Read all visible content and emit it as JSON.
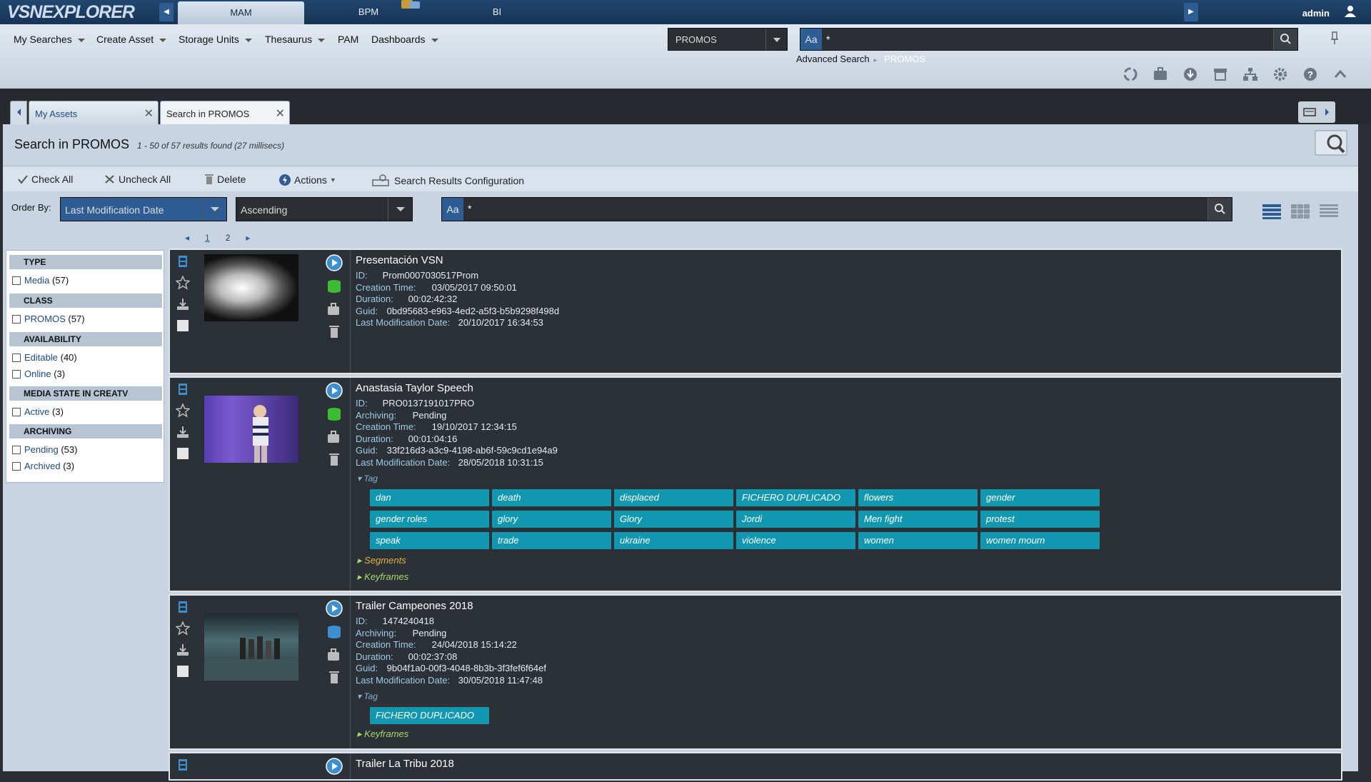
{
  "app": {
    "logo": "VSNEXPLORER",
    "user": "admin"
  },
  "top_tabs": [
    {
      "label": "MAM"
    },
    {
      "label": "BPM"
    },
    {
      "label": "BI"
    }
  ],
  "menu": {
    "items": [
      {
        "label": "My Searches"
      },
      {
        "label": "Create Asset"
      },
      {
        "label": "Storage Units"
      },
      {
        "label": "Thesaurus"
      },
      {
        "label": "PAM"
      },
      {
        "label": "Dashboards"
      }
    ],
    "scope_select": "PROMOS",
    "search": {
      "case_label": "Aa",
      "value": "*"
    },
    "breadcrumb": {
      "link": "Advanced Search",
      "current": "PROMOS"
    }
  },
  "work_tabs": [
    {
      "label": "My Assets"
    },
    {
      "label": "Search in PROMOS"
    }
  ],
  "panel": {
    "title": "Search in PROMOS",
    "count": "1 - 50 of 57 results found (27 millisecs)",
    "actions": {
      "check_all": "Check All",
      "uncheck_all": "Uncheck All",
      "delete": "Delete",
      "actions": "Actions",
      "config": "Search Results Configuration"
    },
    "order_by_label": "Order By:",
    "order_field": "Last Modification Date",
    "order_direction": "Ascending",
    "search": {
      "case_label": "Aa",
      "value": "*"
    },
    "pages": [
      "1",
      "2"
    ]
  },
  "facets": [
    {
      "title": "TYPE",
      "items": [
        {
          "label": "Media",
          "count": "(57)"
        }
      ]
    },
    {
      "title": "CLASS",
      "items": [
        {
          "label": "PROMOS",
          "count": "(57)"
        }
      ]
    },
    {
      "title": "AVAILABILITY",
      "items": [
        {
          "label": "Editable",
          "count": "(40)"
        },
        {
          "label": "Online",
          "count": "(3)"
        }
      ]
    },
    {
      "title": "MEDIA STATE IN CREATV",
      "items": [
        {
          "label": "Active",
          "count": "(3)"
        }
      ]
    },
    {
      "title": "ARCHIVING",
      "items": [
        {
          "label": "Pending",
          "count": "(53)"
        },
        {
          "label": "Archived",
          "count": "(3)"
        }
      ]
    }
  ],
  "results": [
    {
      "title": "Presentación VSN",
      "fields": [
        {
          "k": "ID:",
          "v": "Prom0007030517Prom"
        },
        {
          "k": "Creation Time:",
          "v": "03/05/2017 09:50:01"
        },
        {
          "k": "Duration:",
          "v": "00:02:42:32"
        },
        {
          "k": "Guid:",
          "v": "0bd95683-e963-4ed2-a5f3-b5b9298f498d"
        },
        {
          "k": "Last Modification Date:",
          "v": "20/10/2017 16:34:53"
        }
      ]
    },
    {
      "title": "Anastasia Taylor Speech",
      "fields": [
        {
          "k": "ID:",
          "v": "PRO0137191017PRO"
        },
        {
          "k": "Archiving:",
          "v": "Pending"
        },
        {
          "k": "Creation Time:",
          "v": "19/10/2017 12:34:15"
        },
        {
          "k": "Duration:",
          "v": "00:01:04:16"
        },
        {
          "k": "Guid:",
          "v": "33f216d3-a3c9-4198-ab6f-59c9cd1e94a9"
        },
        {
          "k": "Last Modification Date:",
          "v": "28/05/2018 10:31:15"
        }
      ],
      "tag_label": "Tag",
      "tags": [
        "dan",
        "death",
        "displaced",
        "FICHERO DUPLICADO",
        "flowers",
        "gender",
        "gender roles",
        "glory",
        "Glory",
        "Jordi",
        "Men fight",
        "protest",
        "speak",
        "trade",
        "ukraine",
        "violence",
        "women",
        "women mourn"
      ],
      "segments": "Segments",
      "keyframes": "Keyframes"
    },
    {
      "title": "Trailer Campeones 2018",
      "fields": [
        {
          "k": "ID:",
          "v": "1474240418"
        },
        {
          "k": "Archiving:",
          "v": "Pending"
        },
        {
          "k": "Creation Time:",
          "v": "24/04/2018 15:14:22"
        },
        {
          "k": "Duration:",
          "v": "00:02:37:08"
        },
        {
          "k": "Guid:",
          "v": "9b04f1a0-00f3-4048-8b3b-3f3fef6f64ef"
        },
        {
          "k": "Last Modification Date:",
          "v": "30/05/2018 11:47:48"
        }
      ],
      "tag_label": "Tag",
      "tags": [
        "FICHERO DUPLICADO"
      ],
      "keyframes": "Keyframes"
    },
    {
      "title": "Trailer La Tribu 2018"
    }
  ]
}
